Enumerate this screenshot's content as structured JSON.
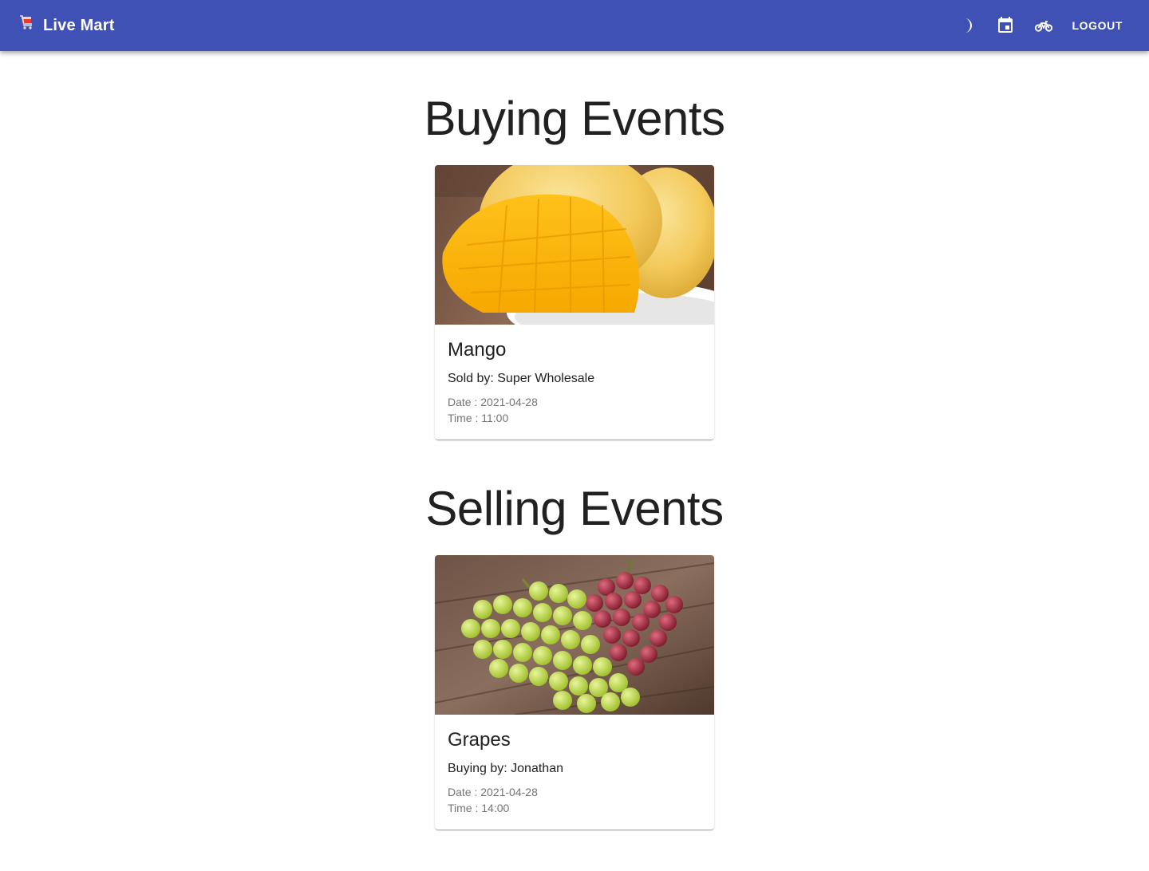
{
  "app": {
    "title": "Live Mart",
    "logo_icon": "shopping-cart-icon"
  },
  "toolbar": {
    "icons": [
      "dark-mode-icon",
      "calendar-event-icon",
      "bike-delivery-icon"
    ],
    "logout_label": "LOGOUT"
  },
  "colors": {
    "appbar": "#3f51b5",
    "title_text": "#212121",
    "secondary_text": "#757575"
  },
  "buying": {
    "heading": "Buying Events",
    "card": {
      "image_subject": "mango",
      "name": "Mango",
      "by": "Sold by: Super Wholesale",
      "date": "Date : 2021-04-28",
      "time": "Time : 11:00"
    }
  },
  "selling": {
    "heading": "Selling Events",
    "card": {
      "image_subject": "grapes",
      "name": "Grapes",
      "by": "Buying by: Jonathan",
      "date": "Date : 2021-04-28",
      "time": "Time : 14:00"
    }
  }
}
